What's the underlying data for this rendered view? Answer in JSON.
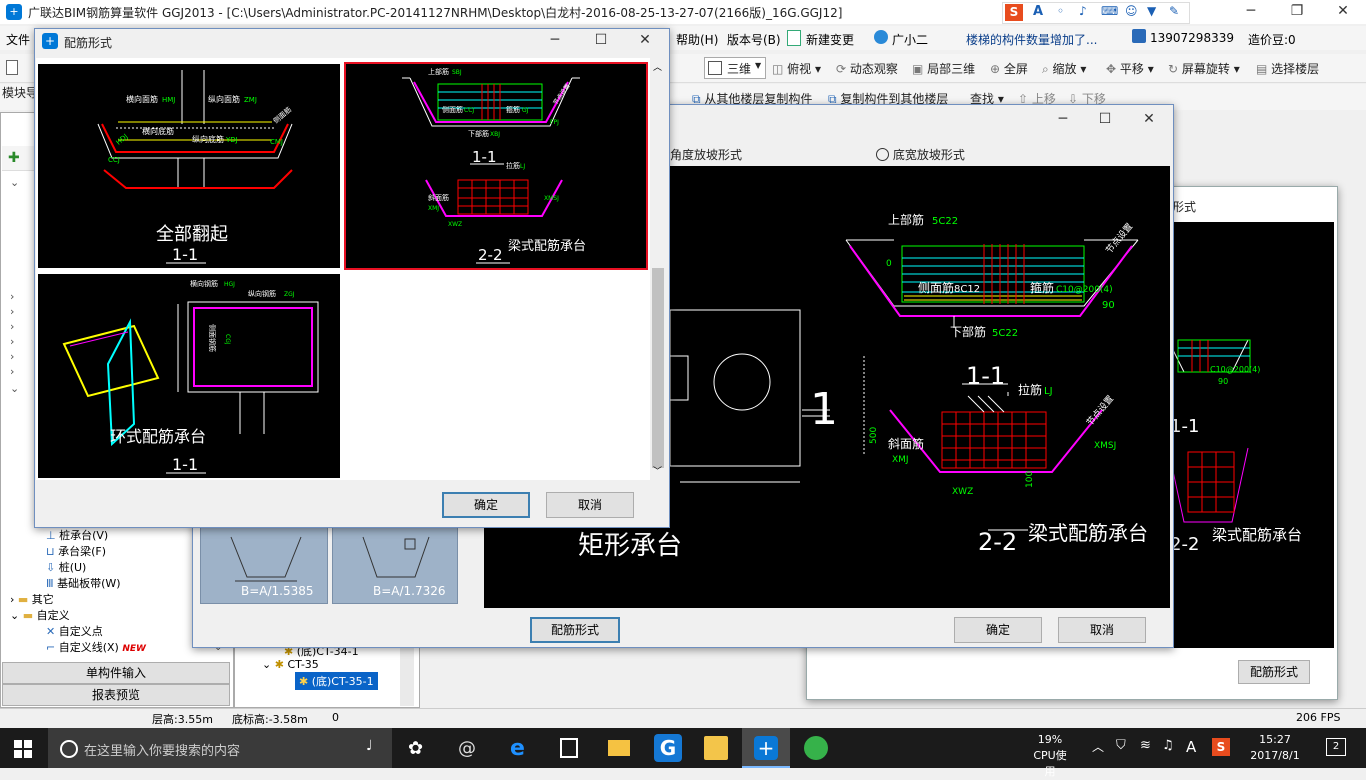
{
  "app": {
    "title": "广联达BIM钢筋算量软件 GGJ2013 - [C:\\Users\\Administrator.PC-20141127NRHM\\Desktop\\白龙村-2016-08-25-13-27-07(2166版)_16G.GGJ12]",
    "ime_letter": "S",
    "ime_a": "A"
  },
  "menubar": {
    "left": "文件",
    "help": "帮助(H)",
    "version": "版本号(B)",
    "new_change": "新建变更",
    "assistant": "广小二",
    "notice": "楼梯的构件数量增加了...",
    "phone": "13907298339",
    "coins": "造价豆:0"
  },
  "toolbar1": {
    "view3d": "三维",
    "top_view": "俯视",
    "dynamic": "动态观察",
    "local3d": "局部三维",
    "fullscreen": "全屏",
    "zoom": "缩放",
    "pan": "平移",
    "rotate": "屏幕旋转",
    "select_floor": "选择楼层"
  },
  "toolbar2": {
    "copy_from": "从其他楼层复制构件",
    "copy_to": "复制构件到其他楼层",
    "find": "查找",
    "up": "上移",
    "down": "下移"
  },
  "left_panel": {
    "module": "模块导",
    "items": [
      {
        "label": "桩承台(V)"
      },
      {
        "label": "承台梁(F)"
      },
      {
        "label": "桩(U)"
      },
      {
        "label": "基础板带(W)"
      },
      {
        "label": "其它"
      },
      {
        "label": "自定义"
      },
      {
        "label": "自定义点"
      },
      {
        "label": "自定义线(X)"
      }
    ],
    "new_badge": "NEW",
    "tab1": "单构件输入",
    "tab2": "报表预览"
  },
  "mid_tree": {
    "items": [
      {
        "label": "(底)CT-34-1"
      },
      {
        "label": "CT-35"
      },
      {
        "label": "(底)CT-35-1"
      }
    ],
    "thumb1": "B=A/1.5385",
    "thumb2": "B=A/1.7326"
  },
  "dialog_shape": {
    "radio1": "角度放坡形式",
    "radio2": "底宽放坡形式",
    "title_big": "矩形承台",
    "label_1": "1",
    "section_top": {
      "upper": "上部筋",
      "upper_v": "5C22",
      "side": "侧面筋",
      "side_v": "8C12",
      "stirrup": "箍筋",
      "stirrup_v": "C10@200(4)",
      "lower": "下部筋",
      "lower_v": "5C22",
      "angle": "90",
      "depth": "0",
      "slope": "节点设置",
      "caption": "1-1"
    },
    "section_bottom": {
      "tie": "拉筋",
      "tie_v": "LJ",
      "slope_bar": "斜面筋",
      "xmj": "XMJ",
      "xmsj": "XMSJ",
      "xwz": "XWZ",
      "dim": "500",
      "dim2": "100",
      "slope": "节点设置",
      "caption": "2-2",
      "name": "梁式配筋承台"
    },
    "btn_form": "配筋形式",
    "btn_ok": "确定",
    "btn_cancel": "取消"
  },
  "dialog_back": {
    "label": "形式",
    "caption1": "1-1",
    "caption2": "2-2",
    "name": "梁式配筋承台",
    "btn_form": "配筋形式",
    "c10": "C10@200(4)",
    "ang": "90"
  },
  "dialog_main": {
    "title": "配筋形式",
    "opt1": {
      "caption": "全部翻起",
      "sub": "1-1",
      "labels": [
        "横向面筋",
        "纵向面筋",
        "横向底筋",
        "纵向底筋",
        "侧面筋"
      ],
      "codes": [
        "HMJ",
        "ZMJ",
        "YDJ",
        "CMJ",
        "HDJ",
        "CCJ"
      ]
    },
    "opt2": {
      "caption": "梁式配筋承台",
      "sub1": "1-1",
      "sub2": "2-2",
      "labels": [
        "上部筋",
        "下部筋",
        "侧面筋",
        "箍筋",
        "拉筋",
        "斜面筋"
      ],
      "codes": [
        "SBJ",
        "XBJ",
        "CCJ",
        "GJ",
        "LJ",
        "FPJ",
        "XMJ",
        "XMSJ",
        "XWZ"
      ],
      "slope": "节点设置"
    },
    "opt3": {
      "caption": "环式配筋承台",
      "sub": "1-1",
      "labels": [
        "横向钢筋",
        "纵向钢筋",
        "侧面钢筋"
      ],
      "codes": [
        "HGJ",
        "ZGJ",
        "CGJ"
      ]
    },
    "btn_ok": "确定",
    "btn_cancel": "取消"
  },
  "statusbar": {
    "floor_height": "层高:3.55m",
    "base_elev": "底标高:-3.58m",
    "zero": "0",
    "fps": "206 FPS"
  },
  "taskbar": {
    "search": "在这里输入你要搜索的内容",
    "cpu": "19%",
    "cpu_label": "CPU使用",
    "ime": "A",
    "time": "15:27",
    "date": "2017/8/1",
    "notif": "2"
  },
  "colors": {
    "accent": "#0078d7",
    "cad_green": "#00ff00",
    "cad_red": "#ff0000",
    "cad_magenta": "#ff00ff",
    "cad_yellow": "#ffff00",
    "cad_cyan": "#00ffff",
    "selection": "#e81123"
  }
}
